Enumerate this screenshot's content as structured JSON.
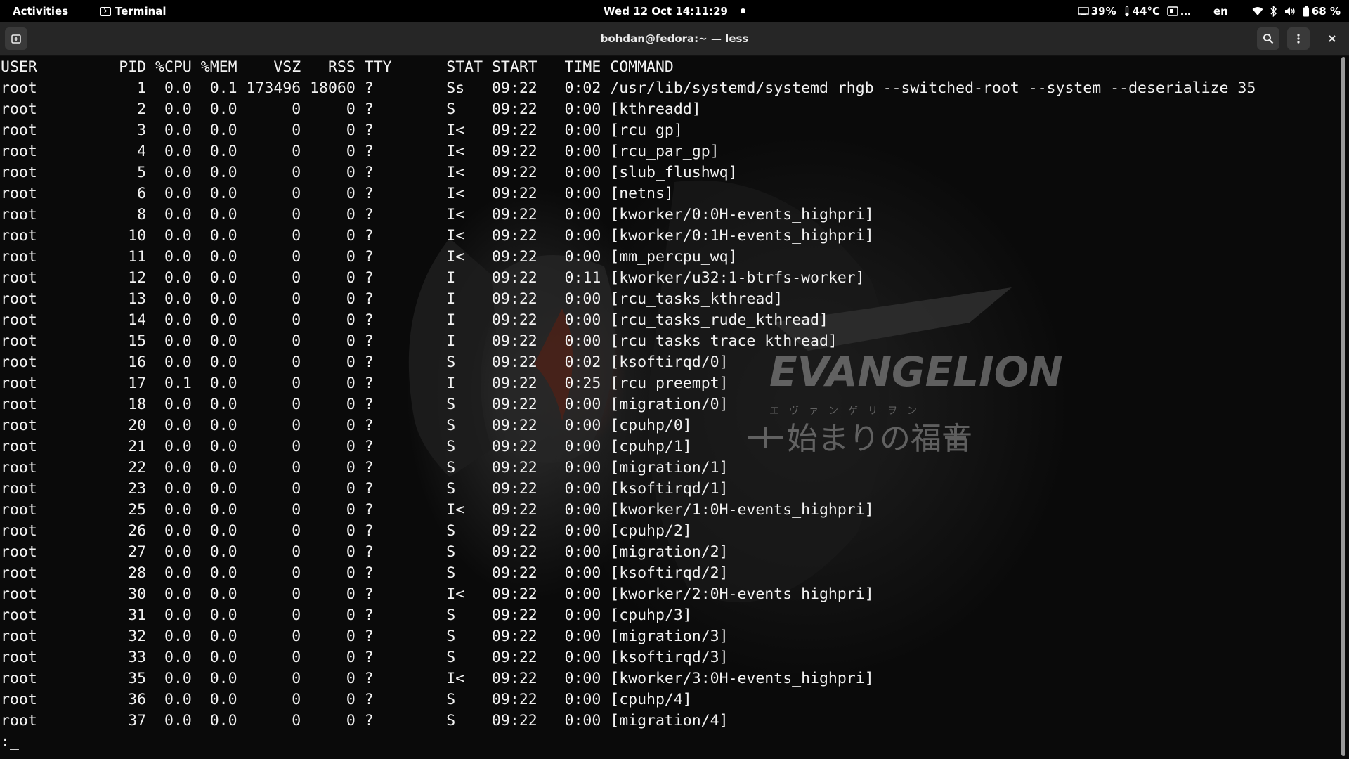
{
  "topbar": {
    "activities": "Activities",
    "app_name": "Terminal",
    "clock": "Wed 12 Oct  14:11:29",
    "cpu": "39%",
    "temp": "44°C",
    "memory_ellipsis": "…",
    "lang": "en",
    "battery": "68 %"
  },
  "window": {
    "title": "bohdan@fedora:~ — less"
  },
  "terminal": {
    "header": "USER         PID %CPU %MEM    VSZ   RSS TTY      STAT START   TIME COMMAND",
    "lines": [
      "root           1  0.0  0.1 173496 18060 ?        Ss   09:22   0:02 /usr/lib/systemd/systemd rhgb --switched-root --system --deserialize 35",
      "root           2  0.0  0.0      0     0 ?        S    09:22   0:00 [kthreadd]",
      "root           3  0.0  0.0      0     0 ?        I<   09:22   0:00 [rcu_gp]",
      "root           4  0.0  0.0      0     0 ?        I<   09:22   0:00 [rcu_par_gp]",
      "root           5  0.0  0.0      0     0 ?        I<   09:22   0:00 [slub_flushwq]",
      "root           6  0.0  0.0      0     0 ?        I<   09:22   0:00 [netns]",
      "root           8  0.0  0.0      0     0 ?        I<   09:22   0:00 [kworker/0:0H-events_highpri]",
      "root          10  0.0  0.0      0     0 ?        I<   09:22   0:00 [kworker/0:1H-events_highpri]",
      "root          11  0.0  0.0      0     0 ?        I<   09:22   0:00 [mm_percpu_wq]",
      "root          12  0.0  0.0      0     0 ?        I    09:22   0:11 [kworker/u32:1-btrfs-worker]",
      "root          13  0.0  0.0      0     0 ?        I    09:22   0:00 [rcu_tasks_kthread]",
      "root          14  0.0  0.0      0     0 ?        I    09:22   0:00 [rcu_tasks_rude_kthread]",
      "root          15  0.0  0.0      0     0 ?        I    09:22   0:00 [rcu_tasks_trace_kthread]",
      "root          16  0.0  0.0      0     0 ?        S    09:22   0:02 [ksoftirqd/0]",
      "root          17  0.1  0.0      0     0 ?        I    09:22   0:25 [rcu_preempt]",
      "root          18  0.0  0.0      0     0 ?        S    09:22   0:00 [migration/0]",
      "root          20  0.0  0.0      0     0 ?        S    09:22   0:00 [cpuhp/0]",
      "root          21  0.0  0.0      0     0 ?        S    09:22   0:00 [cpuhp/1]",
      "root          22  0.0  0.0      0     0 ?        S    09:22   0:00 [migration/1]",
      "root          23  0.0  0.0      0     0 ?        S    09:22   0:00 [ksoftirqd/1]",
      "root          25  0.0  0.0      0     0 ?        I<   09:22   0:00 [kworker/1:0H-events_highpri]",
      "root          26  0.0  0.0      0     0 ?        S    09:22   0:00 [cpuhp/2]",
      "root          27  0.0  0.0      0     0 ?        S    09:22   0:00 [migration/2]",
      "root          28  0.0  0.0      0     0 ?        S    09:22   0:00 [ksoftirqd/2]",
      "root          30  0.0  0.0      0     0 ?        I<   09:22   0:00 [kworker/2:0H-events_highpri]",
      "root          31  0.0  0.0      0     0 ?        S    09:22   0:00 [cpuhp/3]",
      "root          32  0.0  0.0      0     0 ?        S    09:22   0:00 [migration/3]",
      "root          33  0.0  0.0      0     0 ?        S    09:22   0:00 [ksoftirqd/3]",
      "root          35  0.0  0.0      0     0 ?        I<   09:22   0:00 [kworker/3:0H-events_highpri]",
      "root          36  0.0  0.0      0     0 ?        S    09:22   0:00 [cpuhp/4]",
      "root          37  0.0  0.0      0     0 ?        S    09:22   0:00 [migration/4]"
    ],
    "prompt": ":_"
  },
  "wallpaper": {
    "logo_text": "EVANGELION",
    "subtitle_kana": "エヴァンゲリヲン",
    "subtitle_kanji": "始まりの福音"
  }
}
